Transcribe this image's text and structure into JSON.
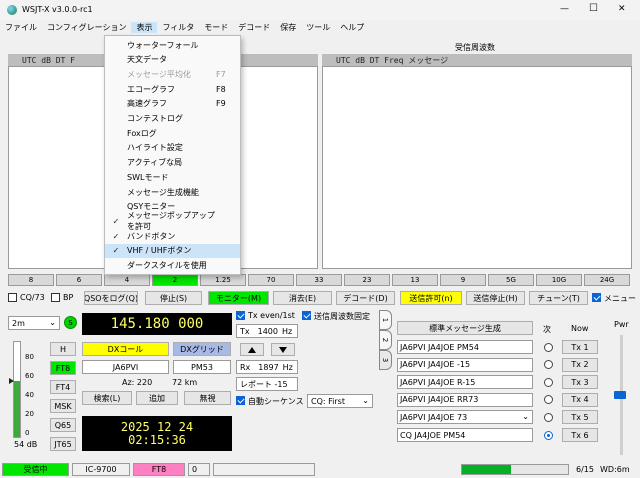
{
  "window": {
    "title": "WSJT-X   v3.0.0-rc1",
    "controls": [
      "—",
      "☐",
      "✕"
    ]
  },
  "menu": [
    "ファイル",
    "コンフィグレーション",
    "表示",
    "フィルタ",
    "モード",
    "デコード",
    "保存",
    "ツール",
    "ヘルプ"
  ],
  "dropdown": {
    "items": [
      {
        "label": "ウォーターフォール",
        "shortcut": "",
        "checked": false,
        "disabled": false,
        "highlight": false
      },
      {
        "label": "天文データ",
        "shortcut": "",
        "checked": false,
        "disabled": false,
        "highlight": false
      },
      {
        "label": "メッセージ平均化",
        "shortcut": "F7",
        "checked": false,
        "disabled": true,
        "highlight": false
      },
      {
        "label": "エコーグラフ",
        "shortcut": "F8",
        "checked": false,
        "disabled": false,
        "highlight": false
      },
      {
        "label": "高速グラフ",
        "shortcut": "F9",
        "checked": false,
        "disabled": false,
        "highlight": false
      },
      {
        "label": "コンテストログ",
        "shortcut": "",
        "checked": false,
        "disabled": false,
        "highlight": false
      },
      {
        "label": "Foxログ",
        "shortcut": "",
        "checked": false,
        "disabled": false,
        "highlight": false
      },
      {
        "label": "ハイライト設定",
        "shortcut": "",
        "checked": false,
        "disabled": false,
        "highlight": false
      },
      {
        "label": "アクティブな局",
        "shortcut": "",
        "checked": false,
        "disabled": false,
        "highlight": false
      },
      {
        "label": "SWLモード",
        "shortcut": "",
        "checked": false,
        "disabled": false,
        "highlight": false
      },
      {
        "label": "メッセージ生成機能",
        "shortcut": "",
        "checked": false,
        "disabled": false,
        "highlight": false
      },
      {
        "label": "QSYモニター",
        "shortcut": "",
        "checked": false,
        "disabled": false,
        "highlight": false
      },
      {
        "label": "メッセージポップアップを許可",
        "shortcut": "",
        "checked": true,
        "disabled": false,
        "highlight": false
      },
      {
        "label": "バンドボタン",
        "shortcut": "",
        "checked": true,
        "disabled": false,
        "highlight": false
      },
      {
        "label": "VHF / UHFボタン",
        "shortcut": "",
        "checked": true,
        "disabled": false,
        "highlight": true
      },
      {
        "label": "ダークスタイルを使用",
        "shortcut": "",
        "checked": false,
        "disabled": false,
        "highlight": false
      }
    ]
  },
  "left_panel": {
    "head_a": "UTC    dB   DT F"
  },
  "right_panel": {
    "title": "受信周波数",
    "head": "UTC    dB   DT Freq    メッセージ"
  },
  "band_cells": [
    "8",
    "6",
    "4",
    "2",
    "1.25",
    "70",
    "33",
    "23",
    "13",
    "9",
    "5G",
    "10G",
    "24G"
  ],
  "controls_row": {
    "cq73": "CQ/73",
    "bp": "BP",
    "log_qso": "QSOをログ(Q)",
    "stop": "停止(S)",
    "monitor": "モニター(M)",
    "erase": "消去(E)",
    "decode": "デコード(D)",
    "enable_tx": "送信許可(n)",
    "halt_tx": "送信停止(H)",
    "tune": "チューン(T)",
    "menus": "メニュー"
  },
  "band": {
    "value": "2m",
    "s_button": "S"
  },
  "frequency": "145.180 000",
  "tx_even": "Tx even/1st",
  "hold_tx": "送信周波数固定",
  "tx_freq": {
    "label": "Tx",
    "value": "1400",
    "unit": "Hz"
  },
  "rx_freq": {
    "label": "Rx",
    "value": "1897",
    "unit": "Hz"
  },
  "report": "レポート -15",
  "auto_seq": "自動シーケンス",
  "cq_select": "CQ: First",
  "mode_buttons": [
    "H",
    "FT8",
    "FT4",
    "MSK",
    "Q65",
    "JT65"
  ],
  "meter": {
    "ticks": [
      "80",
      "60",
      "40",
      "20",
      "0"
    ],
    "db_label": "54 dB"
  },
  "dx": {
    "call_btn": "DXコール",
    "grid_btn": "DXグリッド",
    "call": "JA6PVI",
    "grid": "PM53",
    "az": "Az: 220",
    "dist": "72 km",
    "lookup": "検索(L)",
    "add": "追加",
    "ignore": "無視"
  },
  "clock": {
    "date": "2025 12 24",
    "time": "02:15:36"
  },
  "side_tabs": [
    "1",
    "2",
    "3"
  ],
  "messages": {
    "generate": "標準メッセージ生成",
    "next_label": "次",
    "now_label": "Now",
    "rows": [
      {
        "text": "JA6PVI JA4JOE PM54",
        "tx": "Tx 1",
        "selected": false,
        "dropdown": false
      },
      {
        "text": "JA6PVI JA4JOE -15",
        "tx": "Tx 2",
        "selected": false,
        "dropdown": false
      },
      {
        "text": "JA6PVI JA4JOE R-15",
        "tx": "Tx 3",
        "selected": false,
        "dropdown": false
      },
      {
        "text": "JA6PVI JA4JOE RR73",
        "tx": "Tx 4",
        "selected": false,
        "dropdown": false
      },
      {
        "text": "JA6PVI JA4JOE 73",
        "tx": "Tx 5",
        "selected": false,
        "dropdown": true
      },
      {
        "text": "CQ JA4JOE PM54",
        "tx": "Tx 6",
        "selected": true,
        "dropdown": false
      }
    ]
  },
  "pwr_label": "Pwr",
  "status": {
    "receiving": "受信中",
    "rig": "IC-9700",
    "mode": "FT8",
    "count": "0",
    "progress": 0.46,
    "seq": "6/15",
    "wd": "WD:6m"
  },
  "colors": {
    "green": "#00e600",
    "yellow": "#ffff00",
    "pink": "#ff80c0",
    "blue": "#0a64d4"
  }
}
